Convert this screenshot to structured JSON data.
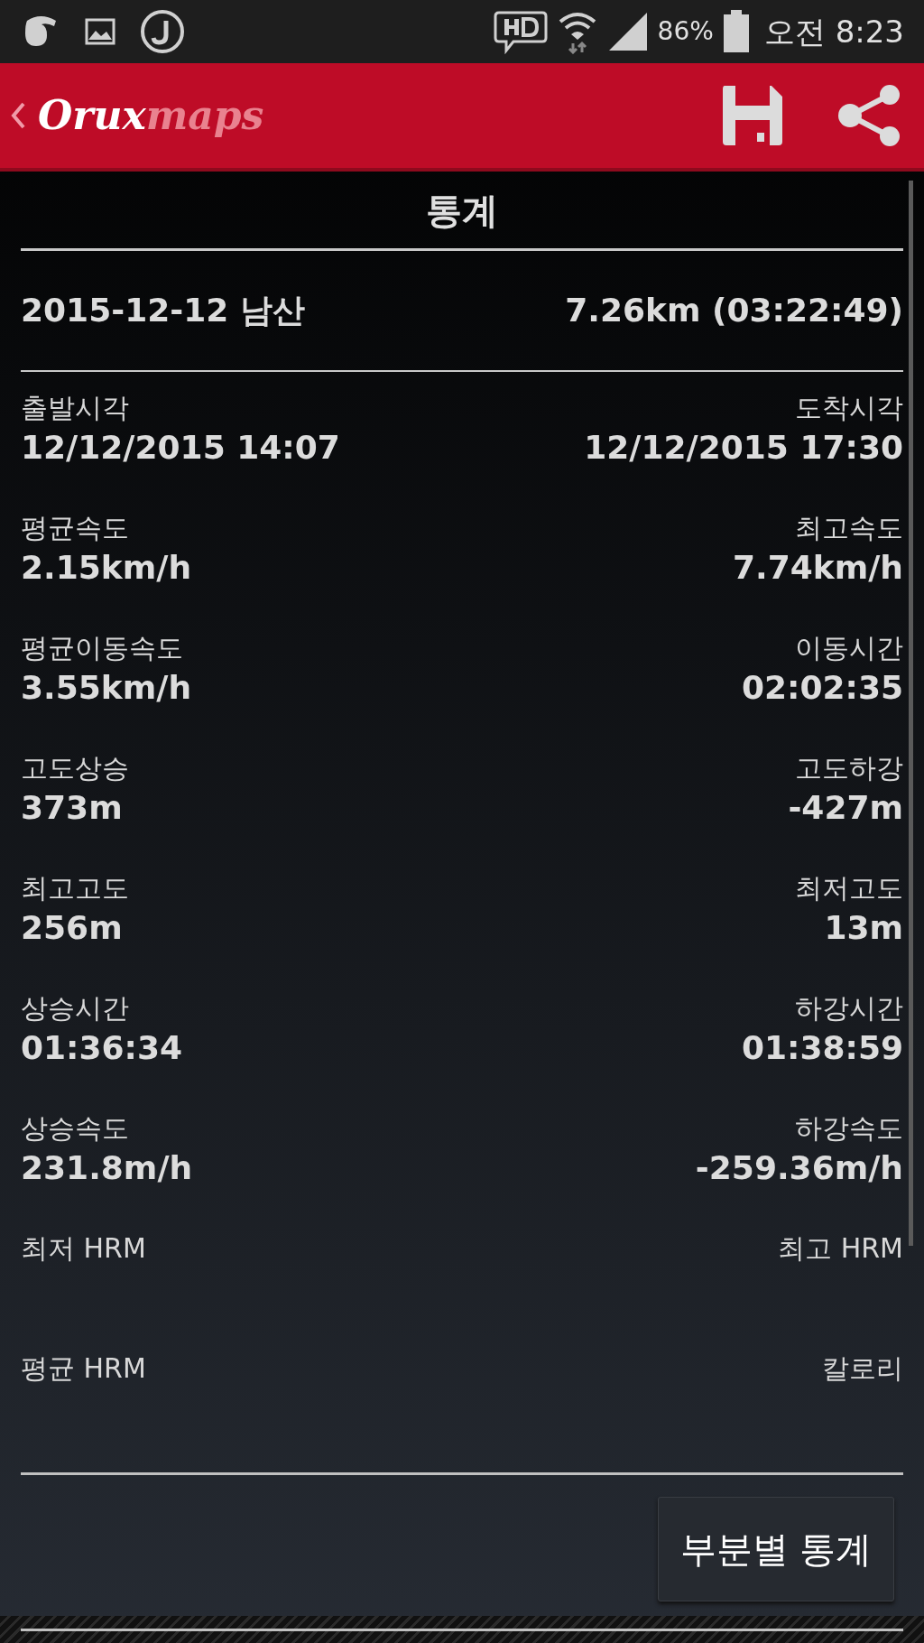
{
  "status_bar": {
    "battery": "86%",
    "time": "오전 8:23"
  },
  "app_bar": {
    "logo": {
      "first": "Orux",
      "second": "maps"
    }
  },
  "title": "통계",
  "track": {
    "name": "2015-12-12 남산",
    "summary": "7.26km (03:22:49)"
  },
  "stats": [
    {
      "left": {
        "label": "출발시각",
        "value": "12/12/2015 14:07"
      },
      "right": {
        "label": "도착시각",
        "value": "12/12/2015 17:30"
      }
    },
    {
      "left": {
        "label": "평균속도",
        "value": "2.15km/h"
      },
      "right": {
        "label": "최고속도",
        "value": "7.74km/h"
      }
    },
    {
      "left": {
        "label": "평균이동속도",
        "value": "3.55km/h"
      },
      "right": {
        "label": "이동시간",
        "value": "02:02:35"
      }
    },
    {
      "left": {
        "label": "고도상승",
        "value": "373m"
      },
      "right": {
        "label": "고도하강",
        "value": "-427m"
      }
    },
    {
      "left": {
        "label": "최고고도",
        "value": "256m"
      },
      "right": {
        "label": "최저고도",
        "value": "13m"
      }
    },
    {
      "left": {
        "label": "상승시간",
        "value": "01:36:34"
      },
      "right": {
        "label": "하강시간",
        "value": "01:38:59"
      }
    },
    {
      "left": {
        "label": "상승속도",
        "value": "231.8m/h"
      },
      "right": {
        "label": "하강속도",
        "value": "-259.36m/h"
      }
    },
    {
      "left": {
        "label": "최저 HRM"
      },
      "right": {
        "label": "최고 HRM"
      }
    },
    {
      "left": {
        "label": "평균 HRM"
      },
      "right": {
        "label": "칼로리"
      }
    }
  ],
  "button": "부분별 통계"
}
